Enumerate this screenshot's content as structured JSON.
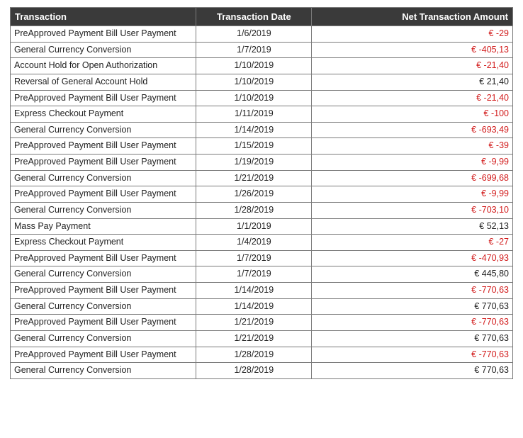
{
  "headers": {
    "transaction": "Transaction",
    "date": "Transaction Date",
    "amount": "Net Transaction Amount"
  },
  "rows": [
    {
      "transaction": "PreApproved Payment Bill User Payment",
      "date": "1/6/2019",
      "amount": "€ -29",
      "negative": true
    },
    {
      "transaction": "General Currency Conversion",
      "date": "1/7/2019",
      "amount": "€ -405,13",
      "negative": true
    },
    {
      "transaction": "Account Hold for Open Authorization",
      "date": "1/10/2019",
      "amount": "€ -21,40",
      "negative": true
    },
    {
      "transaction": "Reversal of General Account Hold",
      "date": "1/10/2019",
      "amount": "€ 21,40",
      "negative": false
    },
    {
      "transaction": "PreApproved Payment Bill User Payment",
      "date": "1/10/2019",
      "amount": "€ -21,40",
      "negative": true
    },
    {
      "transaction": "Express Checkout Payment",
      "date": "1/11/2019",
      "amount": "€ -100",
      "negative": true
    },
    {
      "transaction": "General Currency Conversion",
      "date": "1/14/2019",
      "amount": "€ -693,49",
      "negative": true
    },
    {
      "transaction": "PreApproved Payment Bill User Payment",
      "date": "1/15/2019",
      "amount": "€ -39",
      "negative": true
    },
    {
      "transaction": "PreApproved Payment Bill User Payment",
      "date": "1/19/2019",
      "amount": "€ -9,99",
      "negative": true
    },
    {
      "transaction": "General Currency Conversion",
      "date": "1/21/2019",
      "amount": "€ -699,68",
      "negative": true
    },
    {
      "transaction": "PreApproved Payment Bill User Payment",
      "date": "1/26/2019",
      "amount": "€ -9,99",
      "negative": true
    },
    {
      "transaction": "General Currency Conversion",
      "date": "1/28/2019",
      "amount": "€ -703,10",
      "negative": true
    },
    {
      "transaction": "Mass Pay Payment",
      "date": "1/1/2019",
      "amount": "€ 52,13",
      "negative": false
    },
    {
      "transaction": "Express Checkout Payment",
      "date": "1/4/2019",
      "amount": "€ -27",
      "negative": true
    },
    {
      "transaction": "PreApproved Payment Bill User Payment",
      "date": "1/7/2019",
      "amount": "€ -470,93",
      "negative": true
    },
    {
      "transaction": "General Currency Conversion",
      "date": "1/7/2019",
      "amount": "€ 445,80",
      "negative": false
    },
    {
      "transaction": "PreApproved Payment Bill User Payment",
      "date": "1/14/2019",
      "amount": "€ -770,63",
      "negative": true
    },
    {
      "transaction": "General Currency Conversion",
      "date": "1/14/2019",
      "amount": "€ 770,63",
      "negative": false
    },
    {
      "transaction": "PreApproved Payment Bill User Payment",
      "date": "1/21/2019",
      "amount": "€ -770,63",
      "negative": true
    },
    {
      "transaction": "General Currency Conversion",
      "date": "1/21/2019",
      "amount": "€ 770,63",
      "negative": false
    },
    {
      "transaction": "PreApproved Payment Bill User Payment",
      "date": "1/28/2019",
      "amount": "€ -770,63",
      "negative": true
    },
    {
      "transaction": "General Currency Conversion",
      "date": "1/28/2019",
      "amount": "€ 770,63",
      "negative": false
    }
  ]
}
